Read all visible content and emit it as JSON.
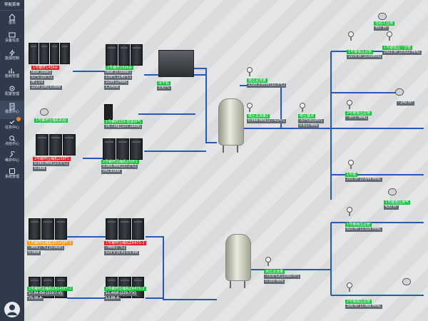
{
  "sidebar": {
    "title": "导航菜单",
    "items": [
      {
        "label": "首页",
        "icon": "home-icon"
      },
      {
        "label": "设备信息",
        "icon": "device-icon"
      },
      {
        "label": "能源控制",
        "icon": "energy-icon"
      },
      {
        "label": "能耗管理",
        "icon": "consumption-icon"
      },
      {
        "label": "配置管理",
        "icon": "config-icon"
      },
      {
        "label": "报表中心",
        "icon": "report-icon"
      },
      {
        "label": "任务中心",
        "icon": "task-icon"
      },
      {
        "label": "点检中心",
        "icon": "inspection-icon"
      },
      {
        "label": "维护中心",
        "icon": "maintenance-icon"
      },
      {
        "label": "系统管理",
        "icon": "system-icon"
      }
    ],
    "active_index": 5,
    "badge_on": "任务中心"
  },
  "top": {
    "rack1": {
      "tag": "1号螺杆145kw",
      "readouts": [
        "0bar [0bar]",
        "0bar [0bar]",
        "57°C [55°C]",
        "停 [ ] 0",
        "229V [0A] 0.0KW"
      ]
    },
    "rack2": {
      "tag": "2号螺杆250kw",
      "readouts": [
        "0bar [0.00bar]",
        "139°C [140°C]",
        "229V [249A]",
        "1.54kW"
      ]
    },
    "dryer": {
      "tag": "冷干机",
      "readout": "3.67°C"
    },
    "flow1": {
      "tag": "低压总流量",
      "readout": "1320.3 m³/h [11.5°C]"
    },
    "flow2": {
      "tag": "低压总流量2",
      "readout": "0.644 MPa [27.41m³]"
    },
    "dew": {
      "tag": "低压露点",
      "readouts": [
        "-57°Cd [0m³]",
        "0.613 MPa"
      ]
    },
    "phone": {
      "tag": "1号螺杆250-智慧供气",
      "readout": "16.71kg [157.16kW]"
    },
    "rack3": {
      "tag": "1号螺杆压缩机机组",
      "readout": ""
    },
    "rack4": {
      "tag": "2号螺杆压缩机250F1",
      "readouts": [
        "0.065 MPa [23.5°C]",
        "0.0KW"
      ]
    },
    "rack5": {
      "tag": "2号螺杆压缩机250F2",
      "readouts": [
        "0.065 MPa [37.2°C]",
        "241.81KW"
      ]
    },
    "branch_a": {
      "tag": "1号楼低压总管",
      "readout": "1974 m³ [0.00MPa]"
    },
    "branch_b": {
      "tag": "1号楼低压一分管",
      "readout": "1423 m³ [0.622 MPa]"
    },
    "branch_c": {
      "tag": "自动工业用",
      "readout": "457 m³"
    },
    "branch_d": {
      "tag": "2号楼低压总管",
      "readout": "- m³ [- MPa]"
    },
    "branch_e": {
      "tag": "",
      "readout": "- 240 m³"
    },
    "branch_f": {
      "tag": "1号楼",
      "readout": "255 m³ [0.644 MPa]"
    },
    "branch_g": {
      "tag": "1号楼低压用气",
      "readout": "420 m³"
    }
  },
  "bottom": {
    "rack1": {
      "tag": "1号螺杆压缩机ZR145FF-1",
      "readouts": [
        "- MPa [- °C] [0.0KW]",
        "0.0KW"
      ]
    },
    "rack2": {
      "tag": "2号螺杆压缩机ZR145FF-2",
      "readouts": [
        "27.84 KW [229.7 V]",
        "75.36 A"
      ]
    },
    "rack3": {
      "tag": "1号螺杆压缩机ZR475-1",
      "readouts": [
        "- MPa [- °C]",
        "229 V [0 A] 0.0 KW"
      ]
    },
    "rack4": {
      "tag": "2号螺杆压缩机ZR475-2",
      "readouts": [
        "11.4KW [229.7 V]",
        "13.88 A"
      ]
    },
    "flow": {
      "tag": "高压总流量",
      "readouts": [
        "-70.6°Cd [1080 m³]",
        "0.000 MPa"
      ]
    },
    "branch_a": {
      "tag": "1号楼高压总管",
      "readout": "620 m³ [1.516 MPa]"
    },
    "branch_b": {
      "tag": "2号楼高压总管",
      "readout": "306 m³ [1.488 MPa]"
    }
  },
  "colors": {
    "pipe": "#2459b8",
    "tag_red": "#e0232a",
    "tag_green": "#1fbe43",
    "tag_orange": "#f39a1a"
  }
}
